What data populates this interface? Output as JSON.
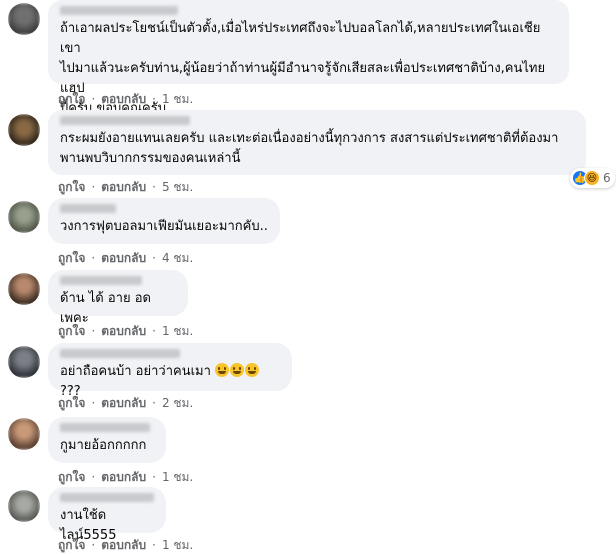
{
  "actions": {
    "like": "ถูกใจ",
    "reply": "ตอบกลับ",
    "sep": "·"
  },
  "comments": [
    {
      "text": "ถ้าเอาผลประโยชน์เป็นตัวตั้ง,เมื่อไหร่ประเทศถึงจะไปบอลโลกได้,หลายประเทศในเอเชียเขา\nไปมาแล้วนะครับท่าน,ผู้น้อยว่าถ้าท่านผู้มีอำนาจรู้จักเสียสละเพื่อประเทศชาติบ้าง,คนไทยแฮป\nปี้ครับ,ขอบคุณครับ.",
      "time": "1 ชม."
    },
    {
      "text": "กระผมยังอายแทนเลยครับ และเทะต่อเนื่องอย่างนี้ทุกวงการ สงสารแต่ประเทศชาติที่ต้องมา\nพานพบวิบากกรรมของคนเหล่านี้",
      "time": "5 ชม.",
      "reactions": {
        "count": "6",
        "icons": [
          "like-icon",
          "haha-icon"
        ]
      }
    },
    {
      "text": "วงการฟุตบอลมาเฟียมันเยอะมากคับ..",
      "time": "4 ชม."
    },
    {
      "text": "ด้าน ได้ อาย อดเพคะ",
      "time": "1 ชม."
    },
    {
      "text": "อย่าถือคนบ้า อย่าว่าคนเมา",
      "emoji_count": 3,
      "emoji": "grinning-face-emoji",
      "suffix": "???",
      "time": "2 ชม."
    },
    {
      "text": "กูมายอ้อกกกกก",
      "time": "1 ชม."
    },
    {
      "text": "งานใช้ดไลน์5555",
      "time": "1 ชม."
    }
  ],
  "colors": {
    "bubble": "#f0f2f5",
    "meta_text": "#65676b",
    "like_blue": "#1877f2",
    "haha_yellow": "#f7b125"
  }
}
